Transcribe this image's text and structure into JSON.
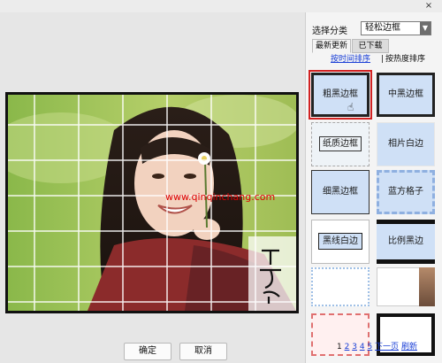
{
  "window": {
    "close_icon": "close-icon"
  },
  "photo": {
    "watermark": "www.qinqinchang.com",
    "signature": "可乐靡"
  },
  "buttons": {
    "ok": "确定",
    "cancel": "取消"
  },
  "sidebar": {
    "category_label": "选择分类",
    "category_value": "轻松边框",
    "tabs": [
      {
        "label": "最新更新"
      },
      {
        "label": "已下载"
      }
    ],
    "sort_by_time": "按时间排序",
    "sort_separator": "|",
    "sort_by_heat": "按热度排序",
    "thumbnails": [
      {
        "label": "粗黑边框",
        "selected": true
      },
      {
        "label": "中黑边框"
      },
      {
        "label": "纸质边框"
      },
      {
        "label": "相片白边"
      },
      {
        "label": "细黑边框"
      },
      {
        "label": "蓝方格子"
      },
      {
        "label": "黑线白边"
      },
      {
        "label": "比例黑边"
      },
      {
        "label": ""
      },
      {
        "label": ""
      },
      {
        "label": ""
      },
      {
        "label": ""
      }
    ],
    "pagination": {
      "pages": [
        "1",
        "2",
        "3",
        "4",
        "5"
      ],
      "next_label": "下一页",
      "refresh_label": "刷新"
    }
  },
  "colors": {
    "selection_highlight": "#d22222",
    "link": "#1a3fd6",
    "tile_blue": "#cfe0f6"
  }
}
